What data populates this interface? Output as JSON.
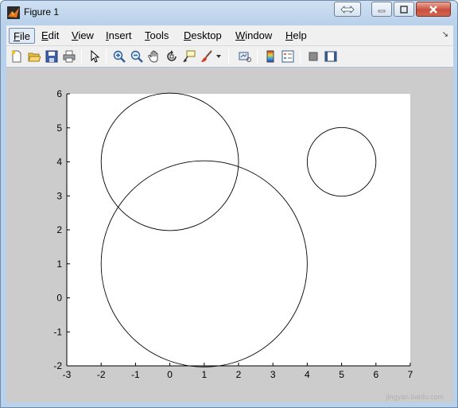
{
  "window": {
    "title": "Figure 1"
  },
  "menu": {
    "items": [
      {
        "mnemonic": "F",
        "rest": "ile"
      },
      {
        "mnemonic": "E",
        "rest": "dit"
      },
      {
        "mnemonic": "V",
        "rest": "iew"
      },
      {
        "mnemonic": "I",
        "rest": "nsert"
      },
      {
        "mnemonic": "T",
        "rest": "ools"
      },
      {
        "mnemonic": "D",
        "rest": "esktop"
      },
      {
        "mnemonic": "W",
        "rest": "indow"
      },
      {
        "mnemonic": "H",
        "rest": "elp"
      }
    ]
  },
  "toolbar": {
    "icons": [
      "new-figure-icon",
      "open-file-icon",
      "save-icon",
      "print-icon",
      "pointer-icon",
      "zoom-in-icon",
      "zoom-out-icon",
      "pan-hand-icon",
      "rotate-3d-icon",
      "data-cursor-icon",
      "brush-icon",
      "brush-dropdown-icon",
      "link-plot-icon",
      "colorbar-icon",
      "legend-icon",
      "hide-plot-tools-icon",
      "show-plot-tools-icon"
    ]
  },
  "chart_data": {
    "type": "scatter",
    "shapes": [
      {
        "kind": "circle",
        "cx": 0,
        "cy": 4,
        "r": 2
      },
      {
        "kind": "circle",
        "cx": 1,
        "cy": 1,
        "r": 3
      },
      {
        "kind": "circle",
        "cx": 5,
        "cy": 4,
        "r": 1
      }
    ],
    "xlim": [
      -3,
      7
    ],
    "ylim": [
      -2,
      6
    ],
    "xticks": [
      "-3",
      "-2",
      "-1",
      "0",
      "1",
      "2",
      "3",
      "4",
      "5",
      "6",
      "7"
    ],
    "yticks": [
      "-2",
      "-1",
      "0",
      "1",
      "2",
      "3",
      "4",
      "5",
      "6"
    ],
    "grid": false,
    "stroke_color": "#000000",
    "axes_background": "#ffffff",
    "figure_background": "#cccccc"
  },
  "watermark": "jingyan.baidu.com"
}
